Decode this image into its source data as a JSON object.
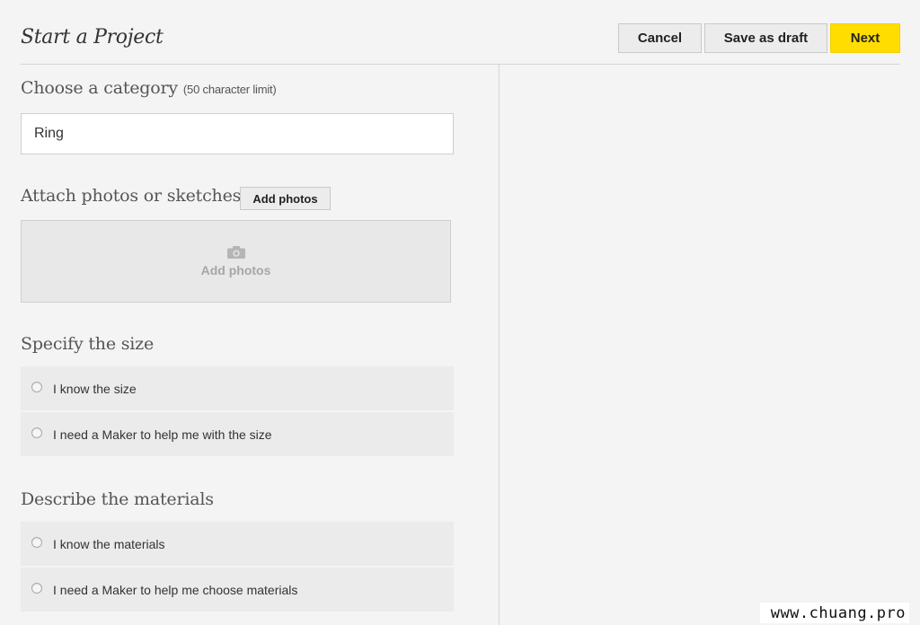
{
  "header": {
    "title": "Start a Project",
    "cancel_label": "Cancel",
    "draft_label": "Save as draft",
    "next_label": "Next",
    "next_color": "#ffdd00"
  },
  "category": {
    "heading": "Choose a category",
    "hint": "(50 character limit)",
    "value": "Ring"
  },
  "photos": {
    "heading": "Attach photos or sketches",
    "button_label": "Add photos",
    "dropzone_icon": "camera-icon",
    "dropzone_label": "Add photos"
  },
  "size": {
    "heading": "Specify the size",
    "options": [
      {
        "label": "I know the size",
        "selected": false
      },
      {
        "label": "I need a Maker to help me with the size",
        "selected": false
      }
    ]
  },
  "materials": {
    "heading": "Describe the materials",
    "options": [
      {
        "label": "I know the materials",
        "selected": false
      },
      {
        "label": "I need a Maker to help me choose materials",
        "selected": false
      }
    ]
  },
  "watermark": "www.chuang.pro"
}
